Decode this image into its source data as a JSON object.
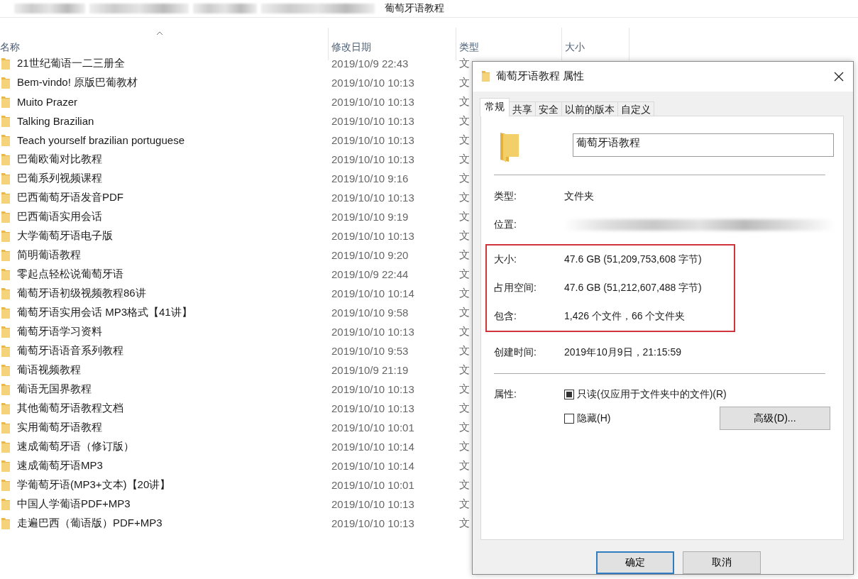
{
  "breadcrumb": {
    "current": "葡萄牙语教程"
  },
  "columns": [
    {
      "label": "名称",
      "sorted": true
    },
    {
      "label": "修改日期",
      "sorted": false
    },
    {
      "label": "类型",
      "sorted": false
    },
    {
      "label": "大小",
      "sorted": false
    }
  ],
  "rows": [
    {
      "name": "21世纪葡语一二三册全",
      "modified": "2019/10/9 22:43",
      "type": "文"
    },
    {
      "name": "Bem-vindo! 原版巴葡教材",
      "modified": "2019/10/10 10:13",
      "type": "文"
    },
    {
      "name": "Muito Prazer",
      "modified": "2019/10/10 10:13",
      "type": "文"
    },
    {
      "name": "Talking Brazilian",
      "modified": "2019/10/10 10:13",
      "type": "文"
    },
    {
      "name": "Teach yourself brazilian portuguese",
      "modified": "2019/10/10 10:13",
      "type": "文"
    },
    {
      "name": "巴葡欧葡对比教程",
      "modified": "2019/10/10 10:13",
      "type": "文"
    },
    {
      "name": "巴葡系列视频课程",
      "modified": "2019/10/10 9:16",
      "type": "文"
    },
    {
      "name": "巴西葡萄牙语发音PDF",
      "modified": "2019/10/10 10:13",
      "type": "文"
    },
    {
      "name": "巴西葡语实用会话",
      "modified": "2019/10/10 9:19",
      "type": "文"
    },
    {
      "name": "大学葡萄牙语电子版",
      "modified": "2019/10/10 10:13",
      "type": "文"
    },
    {
      "name": "简明葡语教程",
      "modified": "2019/10/10 9:20",
      "type": "文"
    },
    {
      "name": "零起点轻松说葡萄牙语",
      "modified": "2019/10/9 22:44",
      "type": "文"
    },
    {
      "name": "葡萄牙语初级视频教程86讲",
      "modified": "2019/10/10 10:14",
      "type": "文"
    },
    {
      "name": "葡萄牙语实用会话 MP3格式【41讲】",
      "modified": "2019/10/10 9:58",
      "type": "文"
    },
    {
      "name": "葡萄牙语学习资料",
      "modified": "2019/10/10 10:13",
      "type": "文"
    },
    {
      "name": "葡萄牙语语音系列教程",
      "modified": "2019/10/10 9:53",
      "type": "文"
    },
    {
      "name": "葡语视频教程",
      "modified": "2019/10/9 21:19",
      "type": "文"
    },
    {
      "name": "葡语无国界教程",
      "modified": "2019/10/10 10:13",
      "type": "文"
    },
    {
      "name": "其他葡萄牙语教程文档",
      "modified": "2019/10/10 10:13",
      "type": "文"
    },
    {
      "name": "实用葡萄牙语教程",
      "modified": "2019/10/10 10:01",
      "type": "文"
    },
    {
      "name": "速成葡萄牙语（修订版）",
      "modified": "2019/10/10 10:14",
      "type": "文"
    },
    {
      "name": "速成葡萄牙语MP3",
      "modified": "2019/10/10 10:14",
      "type": "文"
    },
    {
      "name": "学葡萄牙语(MP3+文本)【20讲】",
      "modified": "2019/10/10 10:01",
      "type": "文"
    },
    {
      "name": "中国人学葡语PDF+MP3",
      "modified": "2019/10/10 10:13",
      "type": "文"
    },
    {
      "name": "走遍巴西（葡语版）PDF+MP3",
      "modified": "2019/10/10 10:13",
      "type": "文"
    }
  ],
  "dialog": {
    "title": "葡萄牙语教程 属性",
    "tabs": [
      {
        "label": "常规",
        "selected": true
      },
      {
        "label": "共享",
        "selected": false
      },
      {
        "label": "安全",
        "selected": false
      },
      {
        "label": "以前的版本",
        "selected": false
      },
      {
        "label": "自定义",
        "selected": false
      }
    ],
    "name_field": {
      "value": "葡萄牙语教程"
    },
    "type": {
      "label": "类型:",
      "value": "文件夹"
    },
    "location": {
      "label": "位置:"
    },
    "highlighted": [
      {
        "label": "大小:",
        "value": "47.6 GB (51,209,753,608 字节)"
      },
      {
        "label": "占用空间:",
        "value": "47.6 GB (51,212,607,488 字节)"
      },
      {
        "label": "包含:",
        "value": "1,426 个文件，66 个文件夹"
      }
    ],
    "created": {
      "label": "创建时间:",
      "value": "2019年10月9日，21:15:59"
    },
    "attributes": {
      "label": "属性:",
      "options": [
        {
          "label": "只读(仅应用于文件夹中的文件)(R)",
          "checked": false,
          "indeterminate": true
        },
        {
          "label": "隐藏(H)",
          "checked": false,
          "indeterminate": false
        }
      ],
      "advanced_button": "高级(D)..."
    },
    "buttons": [
      {
        "label": "确定",
        "default": true
      },
      {
        "label": "取消",
        "default": false
      }
    ]
  }
}
